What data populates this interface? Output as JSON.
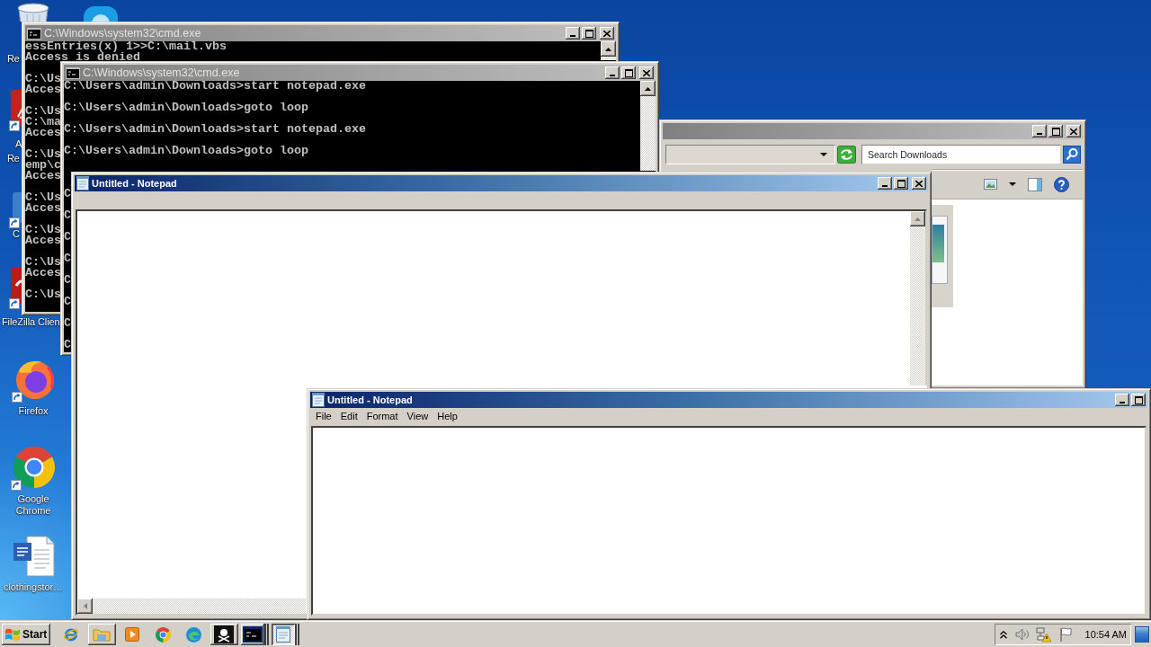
{
  "desktop_icons": [
    {
      "kind": "recycle_bin",
      "label_lines": [
        "Re"
      ]
    },
    {
      "kind": "app"
    },
    {
      "kind": "pdf_shortcut",
      "label_lines": [
        "A",
        "Re"
      ]
    },
    {
      "kind": "shortcut",
      "label_lines": [
        "C"
      ]
    },
    {
      "kind": "filezilla_shortcut",
      "label_lines": [
        "FileZilla Clien"
      ]
    },
    {
      "kind": "firefox_shortcut",
      "label_lines": [
        "Firefox"
      ]
    },
    {
      "kind": "chrome_shortcut",
      "label_lines": [
        "Google",
        "Chrome"
      ]
    },
    {
      "kind": "word_document",
      "label_lines": [
        "clothingstor…"
      ]
    }
  ],
  "windows": [
    {
      "kind": "explorer",
      "active": false,
      "search": {
        "placeholder": "Search Downloads"
      }
    },
    {
      "kind": "console",
      "active": false,
      "title": "C:\\Windows\\system32\\cmd.exe",
      "blocks": [
        [
          "essEntries(x) 1>>C:\\mail.vbs",
          "Access is denied"
        ],
        [
          "C:\\Us",
          "Acces"
        ],
        [
          "C:\\Us",
          "C:\\ma",
          "Acces"
        ],
        [
          "C:\\Us",
          "emp\\c",
          "Acces"
        ],
        [
          "C:\\Us",
          "Acces"
        ],
        [
          "C:\\Us",
          "Acces"
        ],
        [
          "C:\\Us",
          "Acces"
        ],
        [
          "C:\\Us"
        ]
      ]
    },
    {
      "kind": "console",
      "active": false,
      "title": "C:\\Windows\\system32\\cmd.exe",
      "blocks": [
        [
          "C:\\Users\\admin\\Downloads>start notepad.exe"
        ],
        [
          "C:\\Users\\admin\\Downloads>goto loop"
        ],
        [
          "C:\\Users\\admin\\Downloads>start notepad.exe"
        ],
        [
          "C:\\Users\\admin\\Downloads>goto loop"
        ],
        [
          "C"
        ],
        [
          "C"
        ],
        [
          "C"
        ],
        [
          "C"
        ],
        [
          "C"
        ],
        [
          "C"
        ],
        [
          "C"
        ],
        [
          "C"
        ]
      ]
    },
    {
      "kind": "notepad",
      "active": true,
      "title": "Untitled - Notepad"
    },
    {
      "kind": "notepad",
      "active": true,
      "title": "Untitled - Notepad",
      "menu": [
        "File",
        "Edit",
        "Format",
        "View",
        "Help"
      ]
    }
  ],
  "taskbar": {
    "start": {
      "label": "Start"
    },
    "items": [
      {
        "kind": "internet_explorer",
        "running": false,
        "selected": false,
        "grouped": false
      },
      {
        "kind": "file_explorer",
        "running": true,
        "selected": false,
        "grouped": false
      },
      {
        "kind": "media_player",
        "running": false,
        "selected": false,
        "grouped": false
      },
      {
        "kind": "chrome",
        "running": false,
        "selected": false,
        "grouped": false
      },
      {
        "kind": "edge",
        "running": false,
        "selected": false,
        "grouped": false
      },
      {
        "kind": "pirate",
        "running": true,
        "selected": false,
        "grouped": false
      },
      {
        "kind": "console",
        "running": true,
        "selected": false,
        "grouped": true
      },
      {
        "kind": "notepad",
        "running": true,
        "selected": true,
        "grouped": true
      }
    ],
    "tray": {
      "clock": "10:54 AM"
    }
  }
}
